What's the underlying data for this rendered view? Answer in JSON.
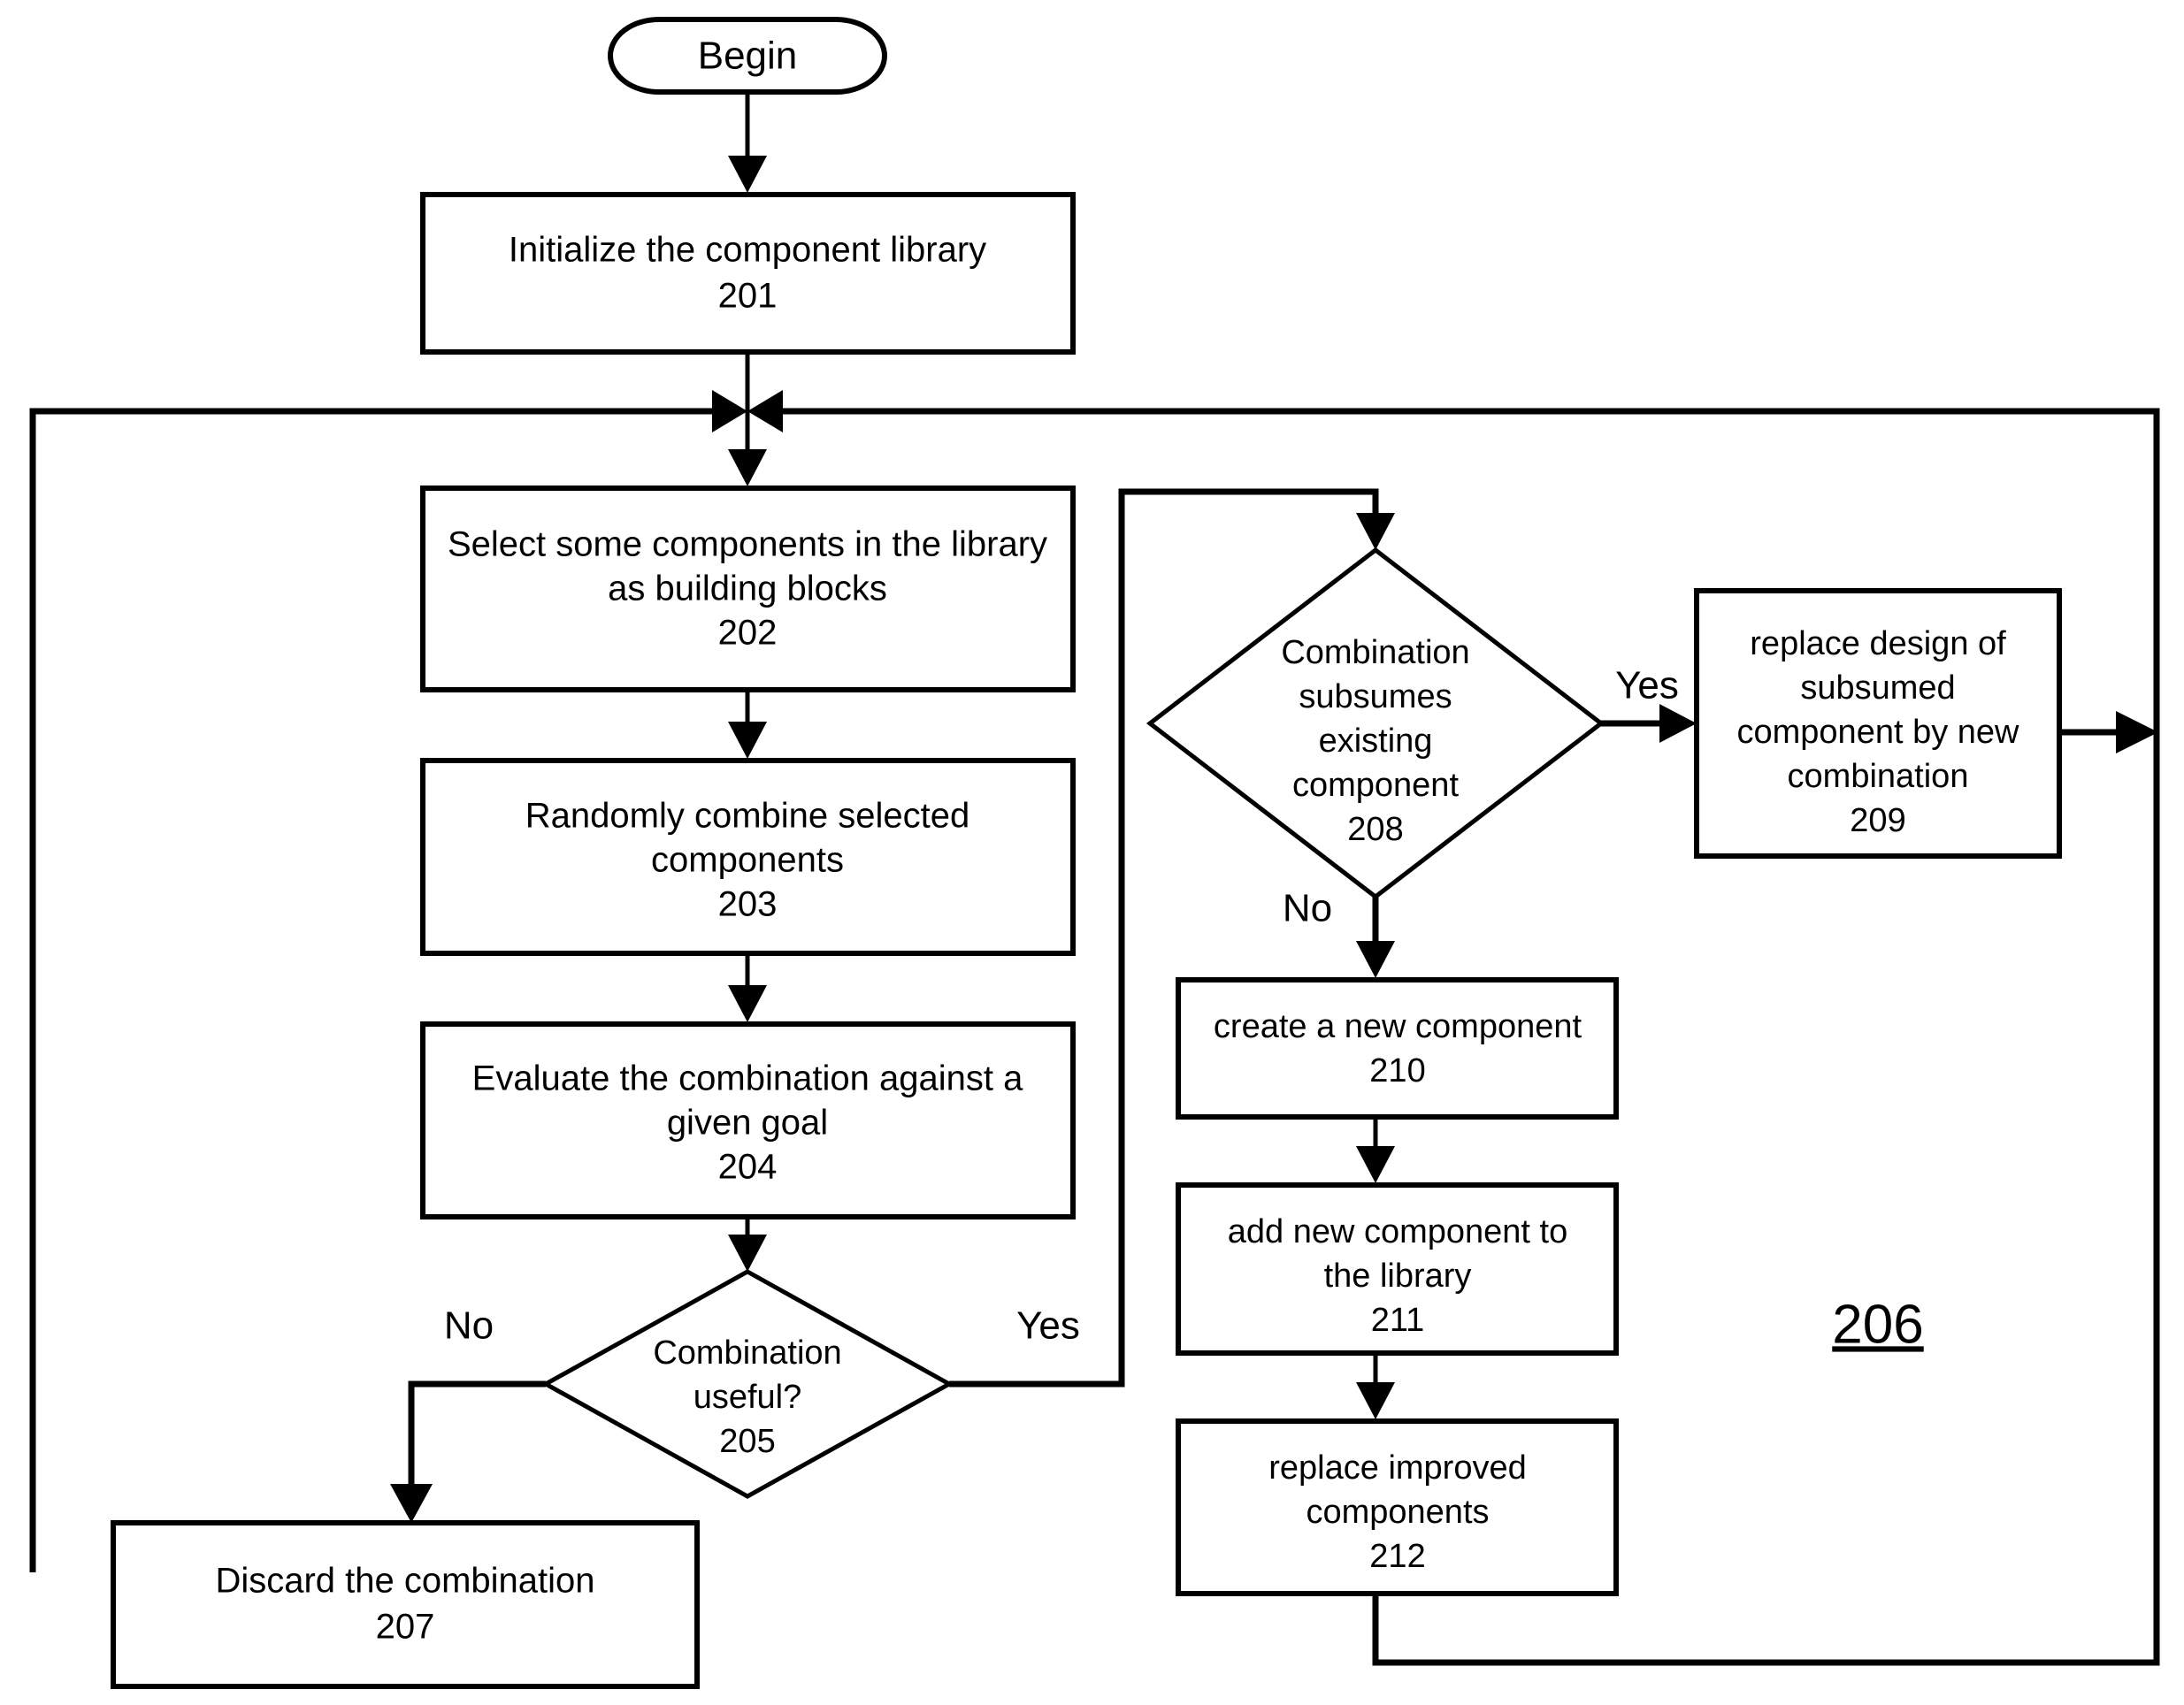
{
  "figure": {
    "type": "flowchart",
    "group_label": "206",
    "background_color": "#ffffff",
    "line_color": "#000000"
  },
  "nodes": {
    "begin": {
      "shape": "terminator",
      "label": "Begin"
    },
    "n201": {
      "shape": "process",
      "line1": "Initialize the component library",
      "number": "201"
    },
    "n202": {
      "shape": "process",
      "line1": "Select some components in the library",
      "line2": "as building blocks",
      "number": "202"
    },
    "n203": {
      "shape": "process",
      "line1": "Randomly combine selected",
      "line2": "components",
      "number": "203"
    },
    "n204": {
      "shape": "process",
      "line1": "Evaluate the combination against a",
      "line2": "given goal",
      "number": "204"
    },
    "n205": {
      "shape": "decision",
      "line1": "Combination",
      "line2": "useful?",
      "number": "205"
    },
    "n207": {
      "shape": "process",
      "line1": "Discard the combination",
      "number": "207"
    },
    "n208": {
      "shape": "decision",
      "line1": "Combination",
      "line2": "subsumes",
      "line3": "existing",
      "line4": "component",
      "number": "208"
    },
    "n209": {
      "shape": "process",
      "line1": "replace design of",
      "line2": "subsumed",
      "line3": "component by new",
      "line4": "combination",
      "number": "209"
    },
    "n210": {
      "shape": "process",
      "line1": "create a new component",
      "number": "210"
    },
    "n211": {
      "shape": "process",
      "line1": "add new component to",
      "line2": "the library",
      "number": "211"
    },
    "n212": {
      "shape": "process",
      "line1": "replace improved",
      "line2": "components",
      "number": "212"
    }
  },
  "edge_labels": {
    "e205_no": "No",
    "e205_yes": "Yes",
    "e208_no": "No",
    "e208_yes": "Yes"
  }
}
